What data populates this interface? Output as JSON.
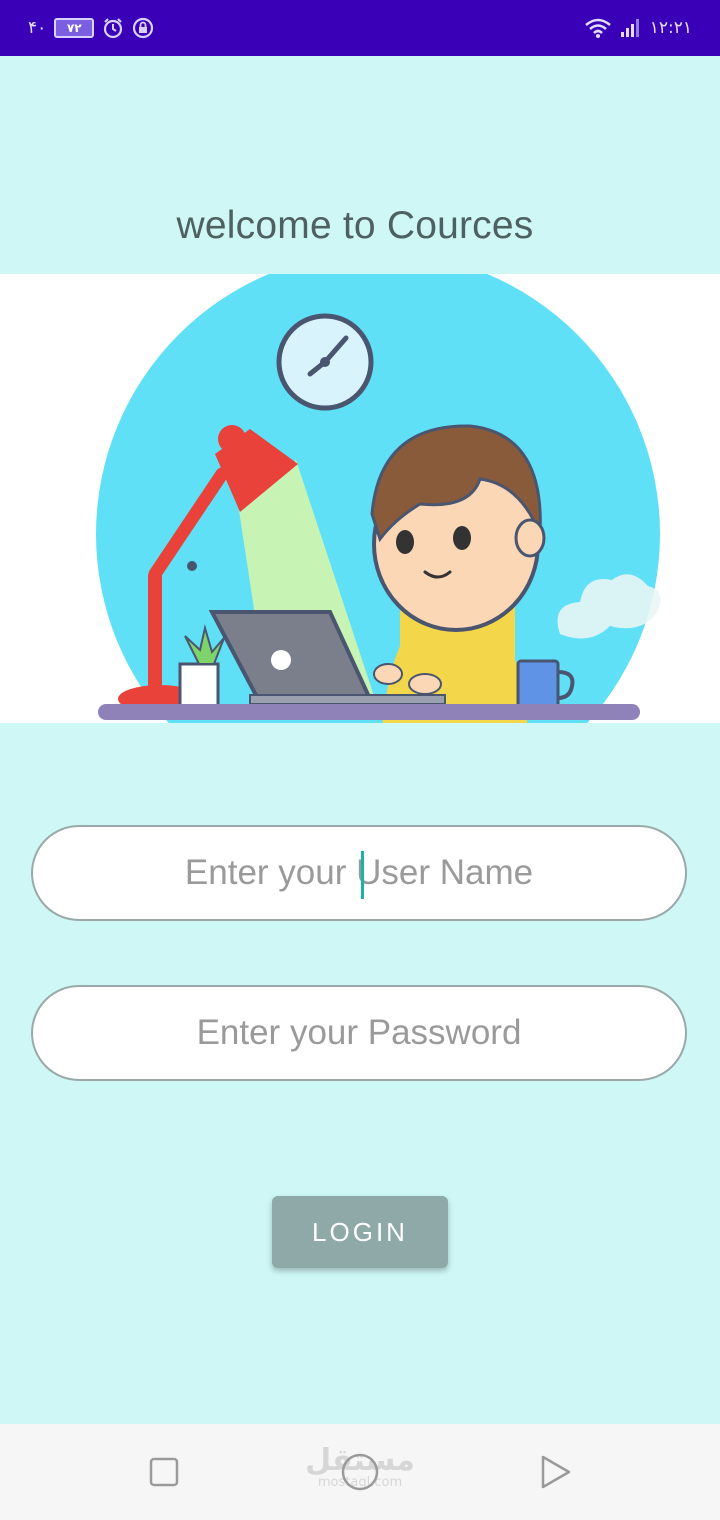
{
  "status_bar": {
    "left_text": "۴۰",
    "battery": "۷۲",
    "time": "۱۲:۲۱",
    "icons": [
      "alarm-icon",
      "lock-icon",
      "wifi-icon",
      "signal-icon"
    ]
  },
  "header": {
    "title": "welcome to Cources"
  },
  "form": {
    "username_placeholder": "Enter your User Name",
    "password_placeholder": "Enter your Password",
    "login_label": "LOGIN"
  },
  "nav_bar": {
    "watermark_ar": "مستقل",
    "watermark_en": "mostaql.com",
    "buttons": [
      "recent-apps-icon",
      "home-icon",
      "back-icon"
    ]
  },
  "colors": {
    "status_bar": "#3a00b8",
    "background": "#cef7f5",
    "button": "#8fa9a8",
    "cursor": "#1bb3a6"
  }
}
